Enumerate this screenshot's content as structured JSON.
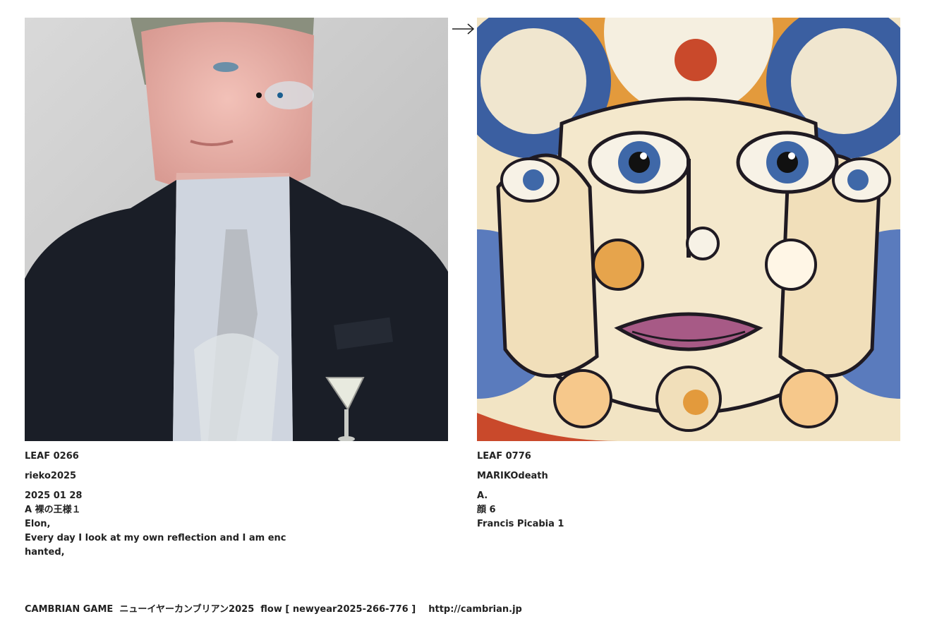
{
  "left": {
    "leaf_id": "LEAF 0266",
    "author": "rieko2025",
    "date": "2025 01 28",
    "lines": [
      "A 裸の王様１",
      "Elon,",
      "Every day I look at my own reflection and I am enc",
      "hanted,"
    ]
  },
  "right": {
    "leaf_id": "LEAF 0776",
    "author": "MARIKOdeath",
    "lines": [
      "A.",
      "顔 6",
      "Francis Picabia 1"
    ]
  },
  "arrow_icon": "right-arrow-icon",
  "footer": {
    "text": "CAMBRIAN GAME  ニューイヤーカンブリアン2025  flow [ newyear2025-266-776 ]    http://cambrian.jp"
  }
}
